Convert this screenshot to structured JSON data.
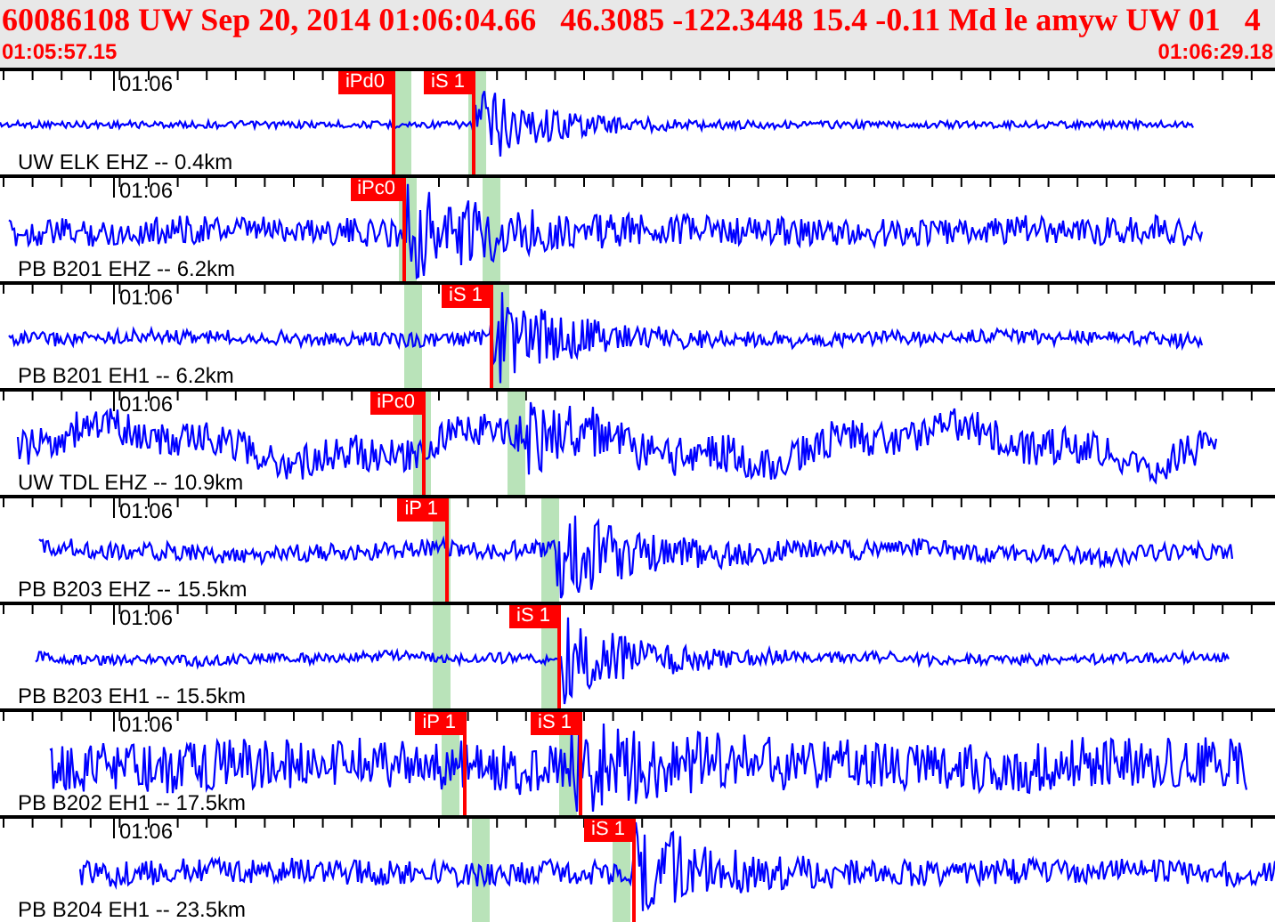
{
  "header": {
    "title": "60086108 UW Sep 20, 2014 01:06:04.66   46.3085 -122.3448 15.4 -0.11 Md le amyw UW 01   4",
    "start_time": "01:05:57.15",
    "end_time": "01:06:29.18"
  },
  "traces": [
    {
      "time_label": "01:06",
      "station": "UW ELK EHZ -- 0.4km",
      "picks": [
        {
          "label": "iPd0"
        },
        {
          "label": "iS 1"
        }
      ]
    },
    {
      "time_label": "01:06",
      "station": "PB B201 EHZ -- 6.2km",
      "picks": [
        {
          "label": "iPc0"
        }
      ]
    },
    {
      "time_label": "01:06",
      "station": "PB B201 EH1 -- 6.2km",
      "picks": [
        {
          "label": "iS 1"
        }
      ]
    },
    {
      "time_label": "01:06",
      "station": "UW TDL EHZ -- 10.9km",
      "picks": [
        {
          "label": "iPc0"
        }
      ]
    },
    {
      "time_label": "01:06",
      "station": "PB B203 EHZ -- 15.5km",
      "picks": [
        {
          "label": "iP 1"
        }
      ]
    },
    {
      "time_label": "01:06",
      "station": "PB B203 EH1 -- 15.5km",
      "picks": [
        {
          "label": "iS 1"
        }
      ]
    },
    {
      "time_label": "01:06",
      "station": "PB B202 EH1 -- 17.5km",
      "picks": [
        {
          "label": "iP 1"
        },
        {
          "label": "iS 1"
        }
      ]
    },
    {
      "time_label": "01:06",
      "station": "PB B204 EH1 -- 23.5km",
      "picks": [
        {
          "label": "iS 1"
        }
      ]
    }
  ]
}
